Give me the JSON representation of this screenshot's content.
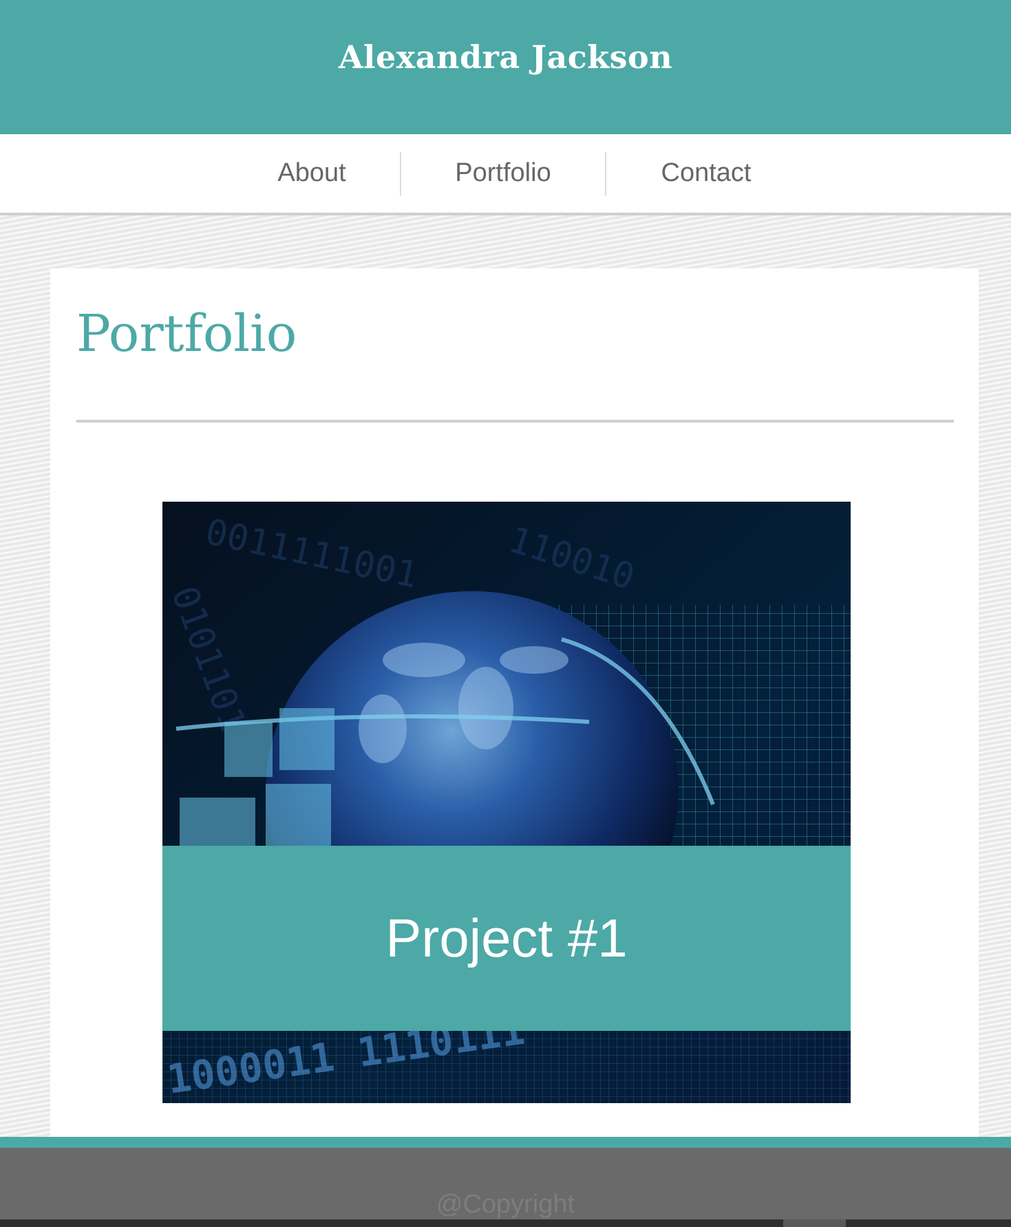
{
  "header": {
    "title": "Alexandra Jackson"
  },
  "nav": {
    "items": [
      {
        "label": "About"
      },
      {
        "label": "Portfolio"
      },
      {
        "label": "Contact"
      }
    ]
  },
  "main": {
    "heading": "Portfolio",
    "projects": [
      {
        "caption": "Project #1",
        "image": "globe-binary-tech-image"
      }
    ]
  },
  "footer": {
    "copyright": "@Copyright"
  },
  "colors": {
    "accent": "#4ca9a6",
    "footer": "#6a6a6a",
    "nav_text": "#666666"
  }
}
